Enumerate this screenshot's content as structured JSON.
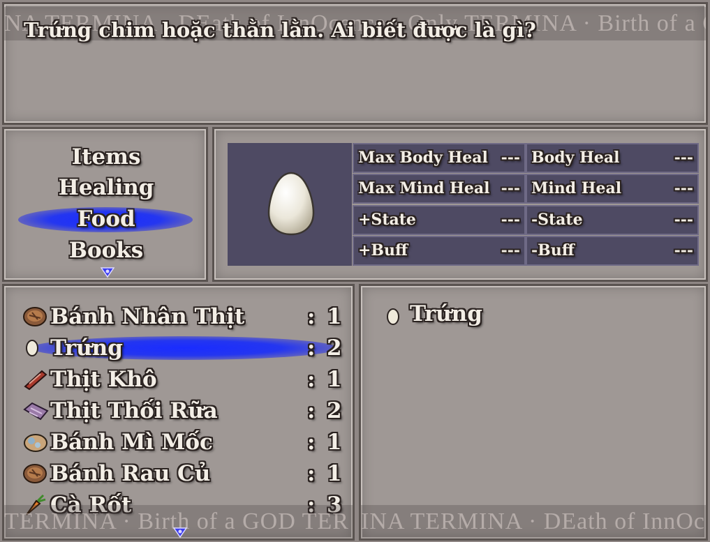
{
  "message": {
    "text": "Trứng chim hoặc thằn lằn. Ai biết được là gì?",
    "ticker_top": "NA TERMINA · DEath of InnOcence · Only TERMINA · Birth of a GOD TERM",
    "ticker_bottom_left": "TERMINA · Birth of a GOD TER",
    "ticker_bottom_right": "INA TERMINA · DEath of InnOcence On"
  },
  "categories": [
    {
      "label": "Items"
    },
    {
      "label": "Healing"
    },
    {
      "label": "Food"
    },
    {
      "label": "Books"
    }
  ],
  "selected_category": "Food",
  "stats": [
    {
      "label": "Max Body Heal",
      "value": "---"
    },
    {
      "label": "Body Heal",
      "value": "---"
    },
    {
      "label": "Max Mind Heal",
      "value": "---"
    },
    {
      "label": "Mind Heal",
      "value": "---"
    },
    {
      "label": "+State",
      "value": "---"
    },
    {
      "label": "-State",
      "value": "---"
    },
    {
      "label": "+Buff",
      "value": "---"
    },
    {
      "label": "-Buff",
      "value": "---"
    }
  ],
  "items": [
    {
      "name": "Bánh Nhân Thịt",
      "colon": ":",
      "qty": "1",
      "icon": "meat-pie-icon"
    },
    {
      "name": "Trứng",
      "colon": ":",
      "qty": "2",
      "icon": "egg-icon"
    },
    {
      "name": "Thịt Khô",
      "colon": ":",
      "qty": "1",
      "icon": "jerky-icon"
    },
    {
      "name": "Thịt Thối Rữa",
      "colon": ":",
      "qty": "2",
      "icon": "rotten-meat-icon"
    },
    {
      "name": "Bánh Mì Mốc",
      "colon": ":",
      "qty": "1",
      "icon": "moldy-bread-icon"
    },
    {
      "name": "Bánh Rau Củ",
      "colon": ":",
      "qty": "1",
      "icon": "veggie-pie-icon"
    },
    {
      "name": "Cà Rốt",
      "colon": ":",
      "qty": "3",
      "icon": "carrot-icon"
    }
  ],
  "selected_item": "Trứng",
  "detail": {
    "name": "Trứng",
    "icon": "egg-icon"
  },
  "colors": {
    "highlight": "#1a2cff",
    "stat_bg": "#4e4a63",
    "window_bg": "#9f9895"
  }
}
